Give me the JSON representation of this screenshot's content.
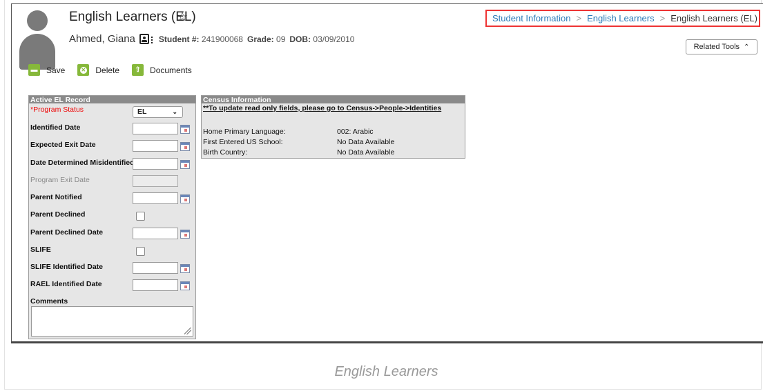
{
  "header": {
    "title": "English Learners (EL)",
    "student_name": "Ahmed, Giana",
    "student_no_label": "Student #:",
    "student_no": "241900068",
    "grade_label": "Grade:",
    "grade": "09",
    "dob_label": "DOB:",
    "dob": "03/09/2010"
  },
  "breadcrumb": {
    "items": [
      "Student Information",
      "English Learners",
      "English Learners (EL)"
    ]
  },
  "related_tools": {
    "label": "Related Tools"
  },
  "toolbar": {
    "save_label": "Save",
    "delete_label": "Delete",
    "documents_label": "Documents"
  },
  "el_record": {
    "header": "Active EL Record",
    "program_status_label": "*Program Status",
    "program_status_value": "EL",
    "identified_date_label": "Identified Date",
    "expected_exit_label": "Expected Exit Date",
    "misidentified_label": "Date Determined Misidentified",
    "program_exit_label": "Program Exit Date",
    "parent_notified_label": "Parent Notified",
    "parent_declined_label": "Parent Declined",
    "parent_declined_date_label": "Parent Declined Date",
    "slife_label": "SLIFE",
    "slife_identified_label": "SLIFE Identified Date",
    "rael_identified_label": "RAEL Identified Date",
    "comments_label": "Comments"
  },
  "census": {
    "header": "Census Information",
    "note": "**To update read only fields, please go to Census->People->Identities",
    "rows": [
      {
        "label": "Home Primary Language:",
        "value": "002: Arabic"
      },
      {
        "label": "First Entered US School:",
        "value": "No Data Available"
      },
      {
        "label": "Birth Country:",
        "value": "No Data Available"
      }
    ]
  },
  "caption": "English Learners",
  "colors": {
    "accent_green": "#86b83a",
    "link_blue": "#2a7ab8",
    "highlight_red": "#e33333",
    "required_red": "#e00000"
  }
}
